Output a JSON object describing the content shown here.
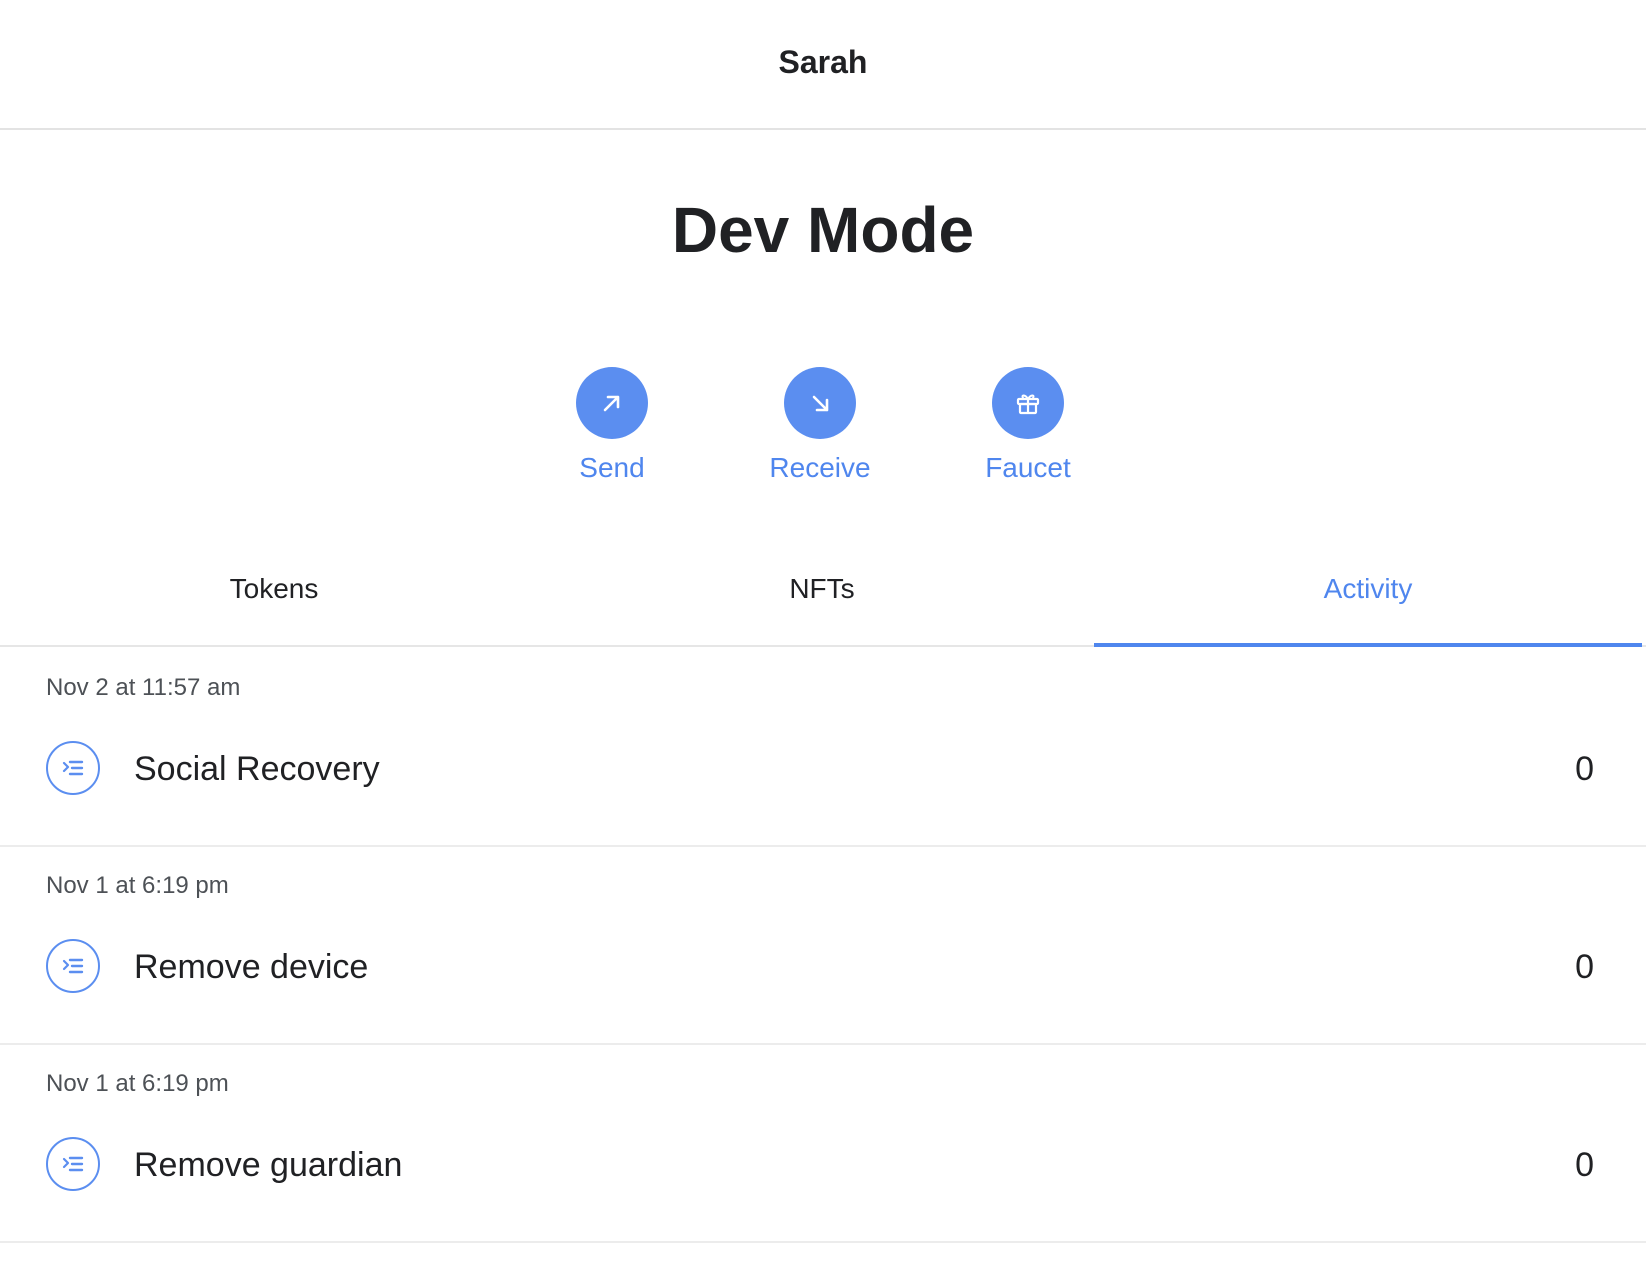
{
  "header": {
    "title": "Sarah"
  },
  "wallet": {
    "name": "Dev Mode"
  },
  "actions": [
    {
      "label": "Send",
      "icon": "arrow-up-right-icon"
    },
    {
      "label": "Receive",
      "icon": "arrow-down-right-icon"
    },
    {
      "label": "Faucet",
      "icon": "gift-icon"
    }
  ],
  "tabs": [
    {
      "label": "Tokens",
      "active": false
    },
    {
      "label": "NFTs",
      "active": false
    },
    {
      "label": "Activity",
      "active": true
    }
  ],
  "activity": [
    {
      "date": "Nov 2 at 11:57 am",
      "title": "Social Recovery",
      "amount": "0",
      "icon": "transaction-list-icon"
    },
    {
      "date": "Nov 1 at 6:19 pm",
      "title": "Remove device",
      "amount": "0",
      "icon": "transaction-list-icon"
    },
    {
      "date": "Nov 1 at 6:19 pm",
      "title": "Remove guardian",
      "amount": "0",
      "icon": "transaction-list-icon"
    }
  ],
  "colors": {
    "accent": "#5b8ef0",
    "accent_text": "#4f86ee",
    "text": "#202124",
    "muted_text": "#4d5156",
    "divider": "#e6e6e6"
  }
}
